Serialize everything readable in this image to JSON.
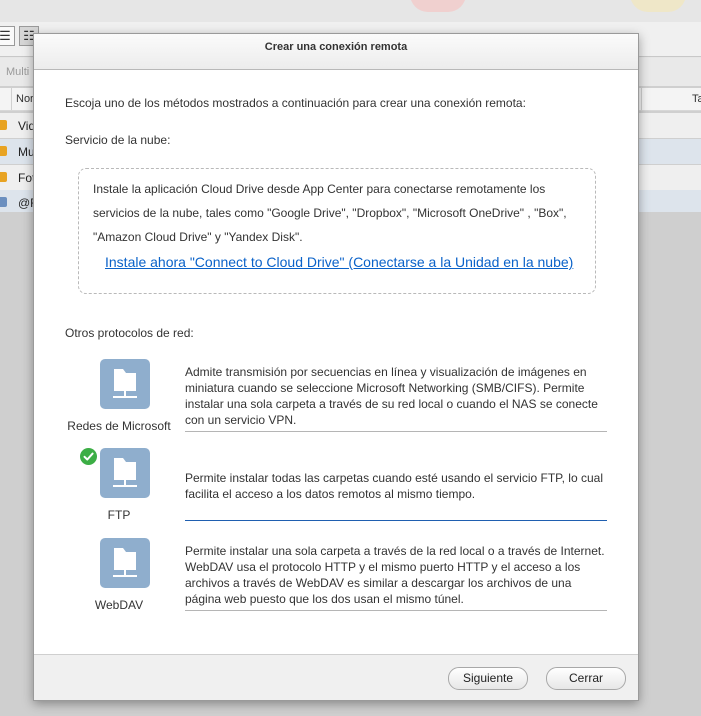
{
  "background": {
    "tab_label": "Multi",
    "header_name": "Nor",
    "header_right": "Ta",
    "rows": [
      "Vid",
      "Mu",
      "Fot",
      "@R"
    ]
  },
  "modal": {
    "title": "Crear una conexión remota",
    "intro": "Escoja uno de los métodos mostrados a continuación para crear una conexión remota:",
    "cloud": {
      "label": "Servicio de la nube:",
      "description": "Instale la aplicación Cloud Drive desde App Center para conectarse remotamente los servicios de la nube, tales como \"Google Drive\", \"Dropbox\", \"Microsoft OneDrive\" , \"Box\", \"Amazon Cloud Drive\" y \"Yandex Disk\".",
      "link": "Instale ahora \"Connect to Cloud Drive\" (Conectarse a la Unidad en la nube)"
    },
    "other_label": "Otros protocolos de red:",
    "protocols": [
      {
        "name": "Redes de Microsoft",
        "icon": "network-folder-icon",
        "selected": false,
        "description": "Admite transmisión por secuencias en línea y visualización de imágenes en miniatura cuando se seleccione Microsoft Networking (SMB/CIFS). Permite instalar una sola carpeta a través de su red local o cuando el NAS se conecte con un servicio VPN."
      },
      {
        "name": "FTP",
        "icon": "network-folder-icon",
        "selected": true,
        "description": "Permite instalar todas las carpetas cuando esté usando el servicio FTP, lo cual facilita el acceso a los datos remotos al mismo tiempo."
      },
      {
        "name": "WebDAV",
        "icon": "network-folder-icon",
        "selected": false,
        "description": "Permite instalar una sola carpeta a través de la red local o a través de Internet. WebDAV usa el protocolo HTTP y el mismo puerto HTTP y el acceso a los archivos a través de WebDAV es similar a descargar los archivos de una página web puesto que los dos usan el mismo túnel."
      }
    ],
    "buttons": {
      "next": "Siguiente",
      "close": "Cerrar"
    }
  },
  "colors": {
    "icon_bg": "#8faecd",
    "link": "#0a62c9",
    "check": "#3cae45",
    "active_line": "#1f5fb0"
  }
}
